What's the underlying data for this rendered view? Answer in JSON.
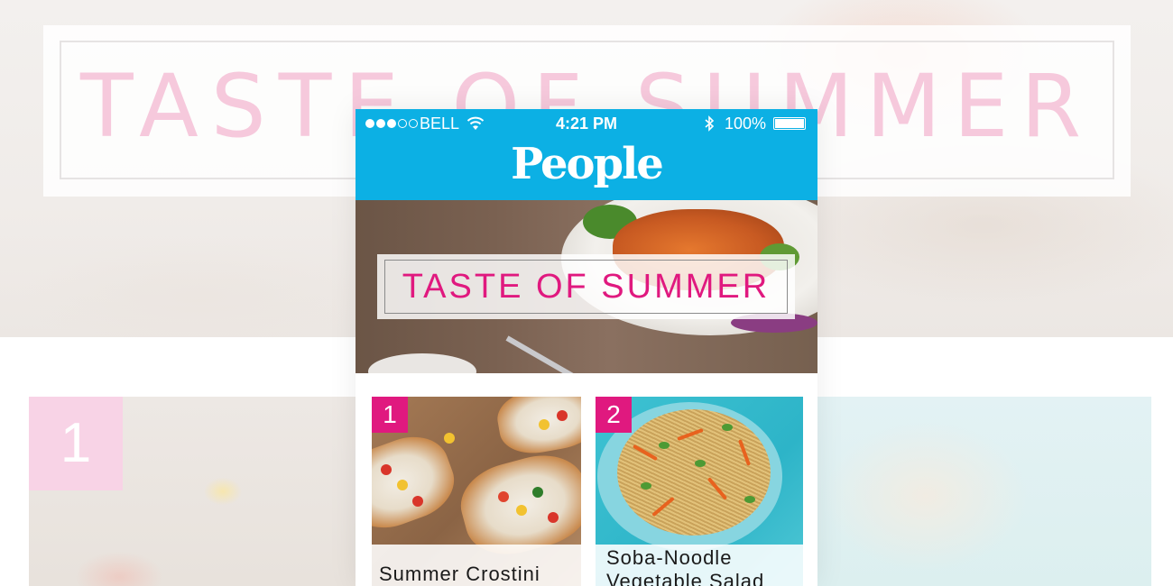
{
  "background": {
    "title": "TASTE OF SUMMER",
    "badge_left": "1"
  },
  "status_bar": {
    "carrier": "BELL",
    "time": "4:21 PM",
    "battery": "100%",
    "signal_bars_filled": 3,
    "signal_bars_total": 5
  },
  "header": {
    "logo": "People",
    "color": "#0cb0e4"
  },
  "hero": {
    "title": "TASTE OF SUMMER"
  },
  "recipes": [
    {
      "number": "1",
      "title": "Summer Crostini"
    },
    {
      "number": "2",
      "title": "Soba-Noodle Vegetable Salad"
    }
  ],
  "colors": {
    "accent": "#e0197f",
    "header": "#0cb0e4"
  },
  "icons": [
    "wifi-icon",
    "bluetooth-icon",
    "battery-icon",
    "signal-icon"
  ]
}
